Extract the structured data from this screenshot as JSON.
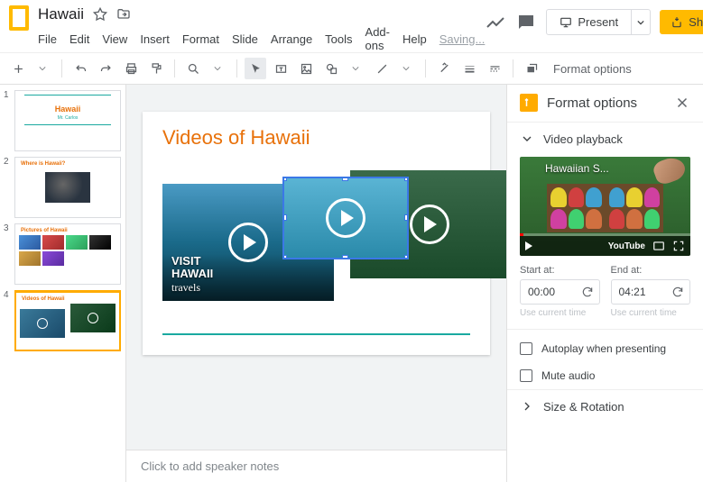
{
  "header": {
    "title": "Hawaii",
    "menu": [
      "File",
      "Edit",
      "View",
      "Insert",
      "Format",
      "Slide",
      "Arrange",
      "Tools",
      "Add-ons",
      "Help"
    ],
    "saving": "Saving...",
    "present": "Present",
    "share": "Share"
  },
  "toolbar": {
    "format_options": "Format options"
  },
  "thumbs": [
    {
      "num": "1",
      "title": "Hawaii",
      "sub": "Mr. Carlos"
    },
    {
      "num": "2",
      "title": "Where is Hawaii?"
    },
    {
      "num": "3",
      "title": "Pictures of Hawaii"
    },
    {
      "num": "4",
      "title": "Videos of Hawaii"
    }
  ],
  "slide": {
    "title": "Videos of Hawaii",
    "video1_line1": "VISIT",
    "video1_line2": "HAWAII",
    "video1_line3": "travels"
  },
  "notes": {
    "placeholder": "Click to add speaker notes"
  },
  "panel": {
    "title": "Format options",
    "section_playback": "Video playback",
    "preview_title": "Hawaiian S...",
    "youtube": "YouTube",
    "start_label": "Start at:",
    "end_label": "End at:",
    "start_value": "00:00",
    "end_value": "04:21",
    "use_current": "Use current time",
    "autoplay": "Autoplay when presenting",
    "mute": "Mute audio",
    "section_size": "Size & Rotation"
  }
}
